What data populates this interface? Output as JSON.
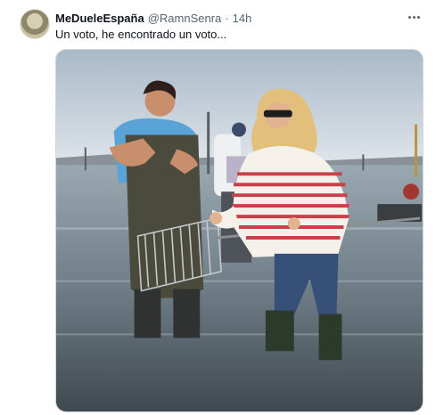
{
  "tweet": {
    "author": {
      "display_name": "MeDueleEspaña",
      "handle": "@RamnSenra",
      "separator": "·",
      "time": "14h"
    },
    "text": "Un voto, he encontrado un voto...",
    "menu_icon": "more-horizontal-icon",
    "media": {
      "alt": "Photo"
    }
  },
  "colors": {
    "text_primary": "#0f1419",
    "text_secondary": "#536471",
    "border": "#cfd9de"
  }
}
